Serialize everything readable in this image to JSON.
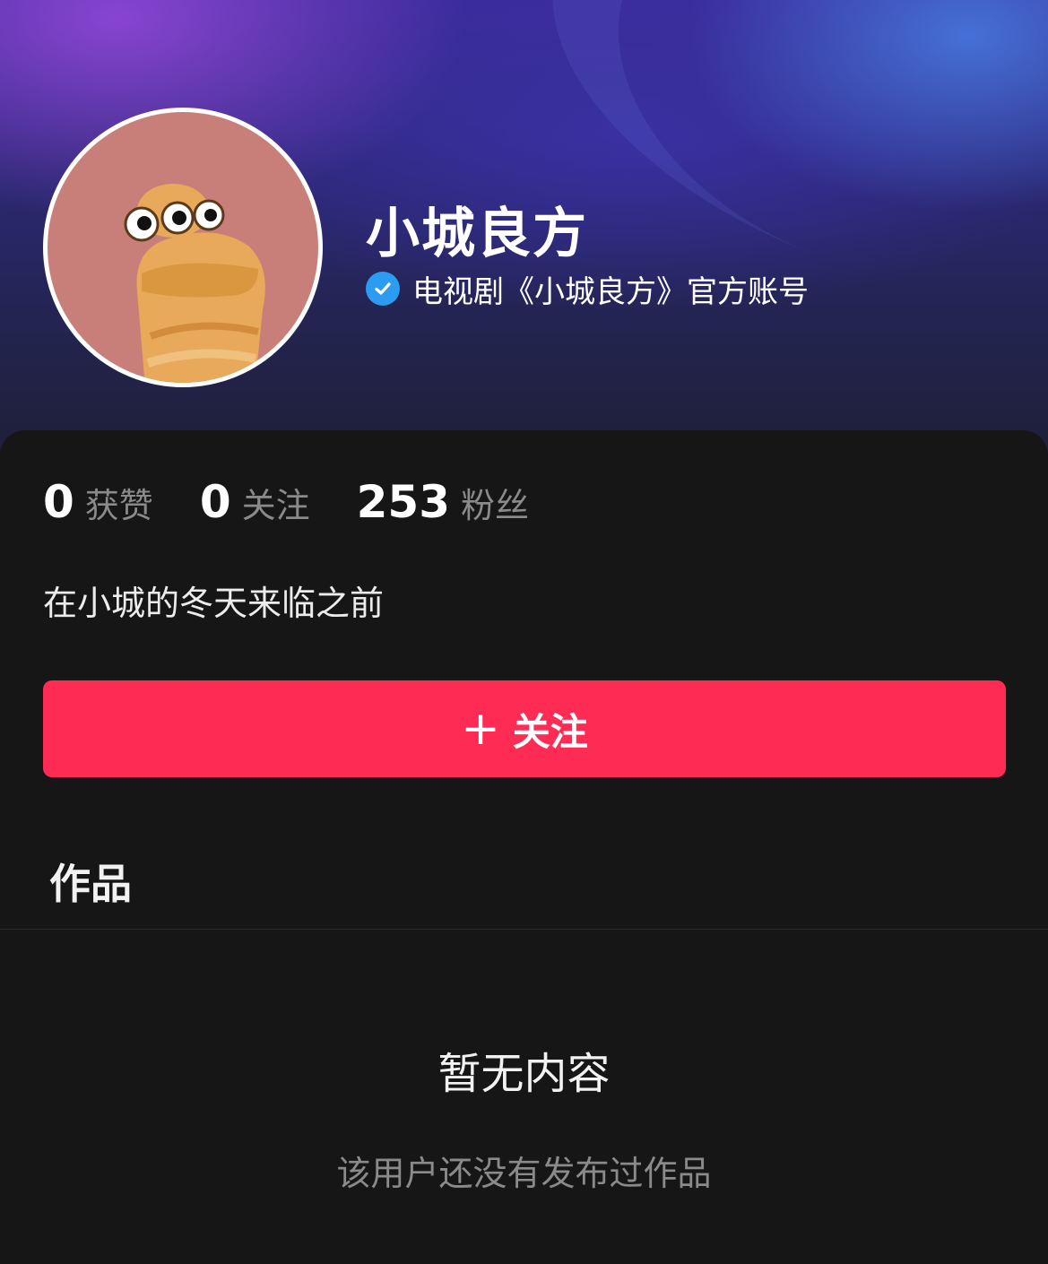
{
  "profile": {
    "name": "小城良方",
    "verification": "电视剧《小城良方》官方账号",
    "bio": "在小城的冬天来临之前"
  },
  "stats": [
    {
      "value": "0",
      "label": "获赞"
    },
    {
      "value": "0",
      "label": "关注"
    },
    {
      "value": "253",
      "label": "粉丝"
    }
  ],
  "actions": {
    "follow_label": "关注",
    "follow_icon": "plus-icon"
  },
  "tabs": {
    "works_label": "作品"
  },
  "empty_state": {
    "title": "暂无内容",
    "subtitle": "该用户还没有发布过作品"
  },
  "colors": {
    "accent": "#fe2c55",
    "verified": "#2c9cf0",
    "background": "#161616"
  }
}
